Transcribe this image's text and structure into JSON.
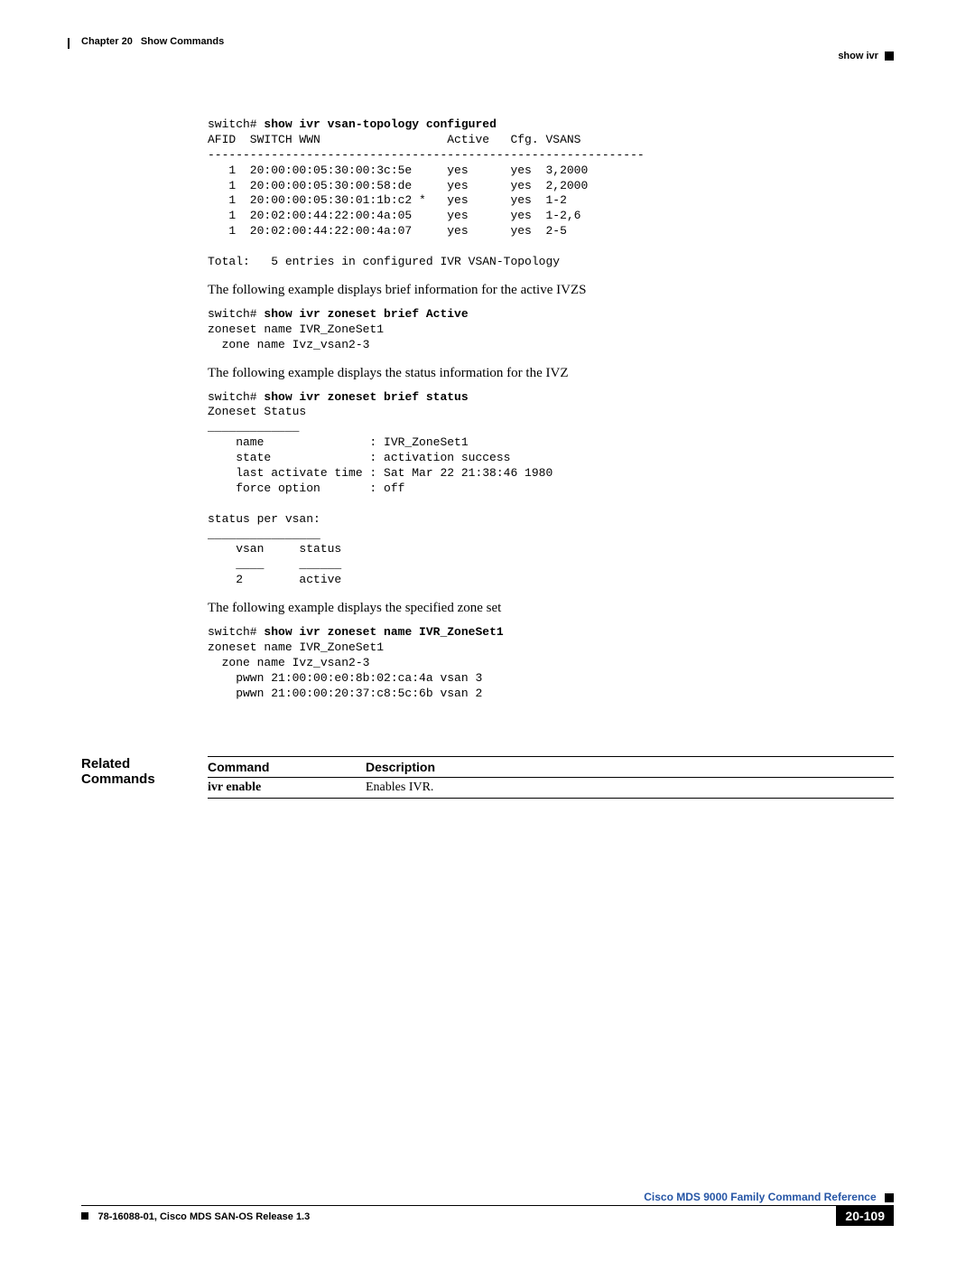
{
  "header": {
    "chapter_num": "Chapter 20",
    "chapter_title": "Show Commands",
    "section_title": "show ivr"
  },
  "code1": {
    "prompt": "switch# ",
    "cmd": "show ivr vsan-topology configured",
    "header": "AFID  SWITCH WWN                  Active   Cfg. VSANS",
    "rule": "--------------------------------------------------------------",
    "r1": "   1  20:00:00:05:30:00:3c:5e     yes      yes  3,2000",
    "r2": "   1  20:00:00:05:30:00:58:de     yes      yes  2,2000",
    "r3": "   1  20:00:00:05:30:01:1b:c2 *   yes      yes  1-2",
    "r4": "   1  20:02:00:44:22:00:4a:05     yes      yes  1-2,6",
    "r5": "   1  20:02:00:44:22:00:4a:07     yes      yes  2-5",
    "total": "Total:   5 entries in configured IVR VSAN-Topology"
  },
  "para1": "The following example displays brief information for the active IVZS",
  "code2": {
    "prompt": "switch# ",
    "cmd": "show ivr zoneset brief Active",
    "l1": "zoneset name IVR_ZoneSet1",
    "l2": "  zone name Ivz_vsan2-3"
  },
  "para2": "The following example displays the status information for the IVZ",
  "code3": {
    "prompt": "switch# ",
    "cmd": "show ivr zoneset brief status",
    "l1": "Zoneset Status",
    "l2": "_____________",
    "l3": "    name               : IVR_ZoneSet1",
    "l4": "    state              : activation success",
    "l5": "    last activate time : Sat Mar 22 21:38:46 1980",
    "l6": "    force option       : off",
    "l7": "",
    "l8": "status per vsan:",
    "l9": "________________",
    "l10": "    vsan     status",
    "l11": "    ____     ______",
    "l12": "    2        active"
  },
  "para3": "The following example displays the specified zone set",
  "code4": {
    "prompt": "switch# ",
    "cmd": "show ivr zoneset name IVR_ZoneSet1",
    "l1": "zoneset name IVR_ZoneSet1",
    "l2": "  zone name Ivz_vsan2-3",
    "l3": "    pwwn 21:00:00:e0:8b:02:ca:4a vsan 3",
    "l4": "    pwwn 21:00:00:20:37:c8:5c:6b vsan 2"
  },
  "related": {
    "label": "Related Commands",
    "header_cmd": "Command",
    "header_desc": "Description",
    "row1_cmd": "ivr enable",
    "row1_desc": "Enables IVR."
  },
  "footer": {
    "ref": "Cisco MDS 9000 Family Command Reference",
    "release": "78-16088-01, Cisco MDS SAN-OS Release 1.3",
    "page": "20-109"
  }
}
